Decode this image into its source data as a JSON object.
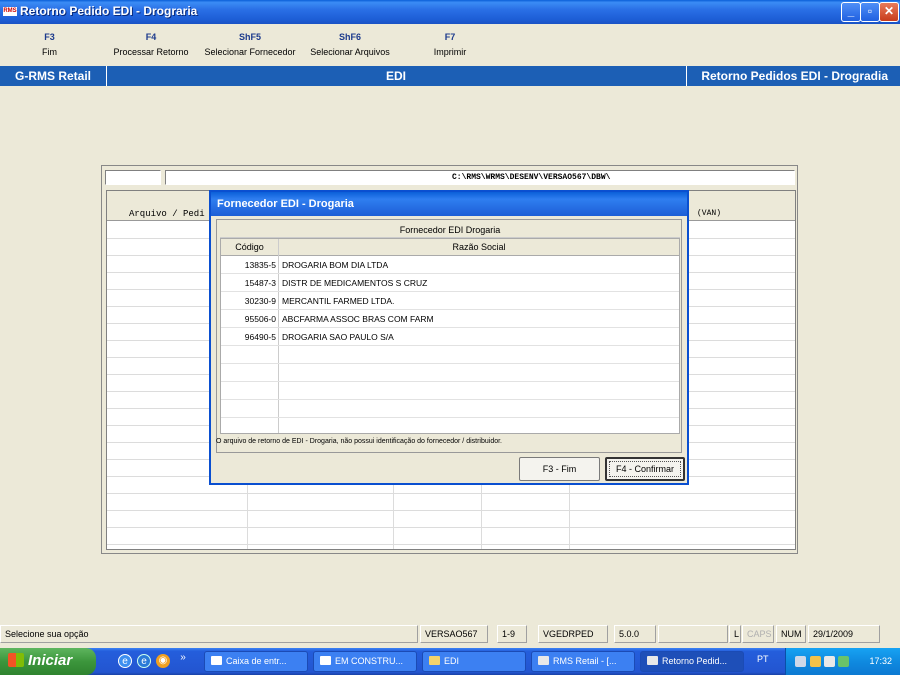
{
  "window": {
    "icon_text": "RMS",
    "title": "Retorno Pedido EDI - Drograria",
    "min_label": "_",
    "max_label": "▫",
    "close_label": "✕"
  },
  "toolbar": {
    "keys": [
      {
        "key": "F3",
        "label": "Fim"
      },
      {
        "key": "F4",
        "label": "Processar Retorno"
      },
      {
        "key": "ShF5",
        "label": "Selecionar Fornecedor"
      },
      {
        "key": "ShF6",
        "label": "Selecionar Arquivos"
      },
      {
        "key": "F7",
        "label": "Imprimir"
      }
    ]
  },
  "header": {
    "left": "G-RMS Retail",
    "center": "EDI",
    "right": "Retorno Pedidos EDI - Drogradia"
  },
  "panel": {
    "path": "C:\\RMS\\WRMS\\DESENV\\VERSAO567\\DBW\\",
    "col_arquivo": "Arquivo / Pedi",
    "col_van": "(VAN)"
  },
  "dialog": {
    "title": "Fornecedor EDI - Drogaria",
    "caption": "Fornecedor EDI Drogaria",
    "col_codigo": "Código",
    "col_razao": "Razão Social",
    "rows": [
      {
        "codigo": "13835-5",
        "razao": "DROGARIA BOM DIA LTDA"
      },
      {
        "codigo": "15487-3",
        "razao": "DISTR DE MEDICAMENTOS S CRUZ"
      },
      {
        "codigo": "30230-9",
        "razao": "MERCANTIL FARMED LTDA."
      },
      {
        "codigo": "95506-0",
        "razao": "ABCFARMA ASSOC BRAS COM FARM"
      },
      {
        "codigo": "96490-5",
        "razao": "DROGARIA SAO PAULO S/A"
      }
    ],
    "message": "O arquivo de retorno de EDI - Drogaria, não possui identificação do fornecedor / distribuidor.",
    "btn_fim": "F3 - Fim",
    "btn_confirmar": "F4 - Confirmar"
  },
  "statusbar": {
    "message": "Selecione sua opção",
    "version": "VERSAO567",
    "range": "1-9",
    "program": "VGEDRPED",
    "release": "5.0.0",
    "l": "L",
    "caps": "CAPS",
    "num": "NUM",
    "date": "29/1/2009"
  },
  "taskbar": {
    "start": "Iniciar",
    "overflow": "»",
    "tasks": [
      {
        "label": "Caixa de entr..."
      },
      {
        "label": "EM CONSTRU..."
      },
      {
        "label": "EDI"
      },
      {
        "label": "RMS Retail - [..."
      },
      {
        "label": "Retorno Pedid..."
      }
    ],
    "lang": "PT",
    "time": "17:32"
  },
  "colors": {
    "header_blue": "#1c5fb5",
    "fkey_blue": "#1c3a8c",
    "xp_taskbar": "#245edc",
    "start_green": "#3c963c"
  }
}
